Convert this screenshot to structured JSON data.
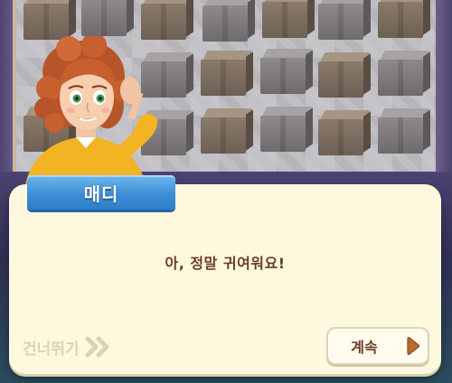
{
  "dialog": {
    "speaker": "매디",
    "line": "아, 정말 귀여워요!"
  },
  "controls": {
    "skip_label": "건너뛰기",
    "continue_label": "계속"
  },
  "colors": {
    "name_tag": "#3d8fd8",
    "dialog_bg": "#fdf8de",
    "text_brown": "#6b3d2a",
    "skip_text": "#d9d2b9",
    "arrow_brown": "#b86b2e"
  },
  "icons": {
    "skip": "double-chevron-right-icon",
    "continue": "arrow-right-icon"
  }
}
